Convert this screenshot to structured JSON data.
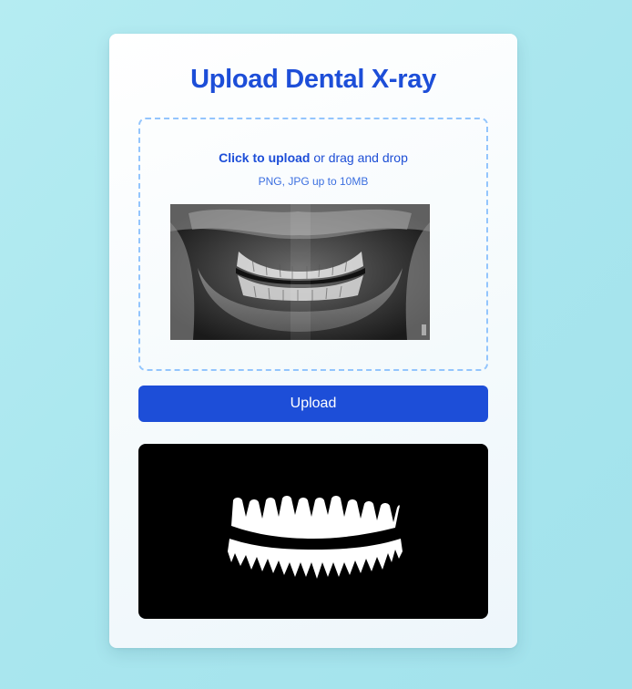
{
  "page": {
    "title": "Upload Dental X-ray"
  },
  "dropzone": {
    "click_label": "Click to upload",
    "drag_label": " or drag and drop",
    "hint": "PNG, JPG up to 10MB"
  },
  "upload_button": {
    "label": "Upload"
  },
  "colors": {
    "accent": "#1d4ed8",
    "dropzone_border": "#93c5fd",
    "background": "#b5ecf2"
  },
  "images": {
    "preview": "dental-panoramic-xray",
    "result": "teeth-segmentation-mask"
  }
}
